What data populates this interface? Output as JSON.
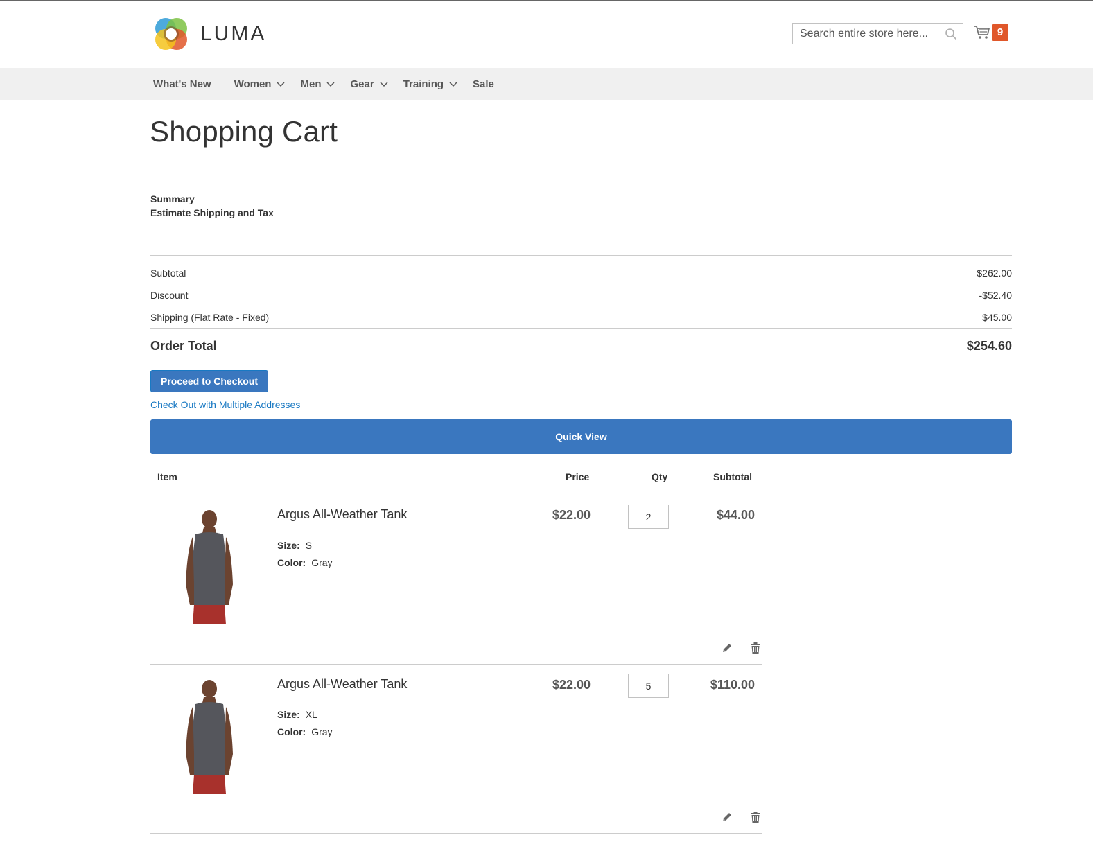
{
  "header": {
    "logo_text": "LUMA",
    "search_placeholder": "Search entire store here...",
    "cart_count": "9",
    "accent_color": "#e0572a"
  },
  "nav": {
    "items": [
      {
        "label": "What's New",
        "has_dropdown": false
      },
      {
        "label": "Women",
        "has_dropdown": true
      },
      {
        "label": "Men",
        "has_dropdown": true
      },
      {
        "label": "Gear",
        "has_dropdown": true
      },
      {
        "label": "Training",
        "has_dropdown": true
      },
      {
        "label": "Sale",
        "has_dropdown": false
      }
    ]
  },
  "page": {
    "title": "Shopping Cart"
  },
  "summary": {
    "title": "Summary",
    "estimate_label": "Estimate Shipping and Tax",
    "rows": [
      {
        "label": "Subtotal",
        "value": "$262.00"
      },
      {
        "label": "Discount",
        "value": "-$52.40"
      },
      {
        "label": "Shipping (Flat Rate - Fixed)",
        "value": "$45.00"
      }
    ],
    "order_total_label": "Order Total",
    "order_total_value": "$254.60",
    "checkout_label": "Proceed to Checkout",
    "multi_address_label": "Check Out with Multiple Addresses",
    "quick_view_label": "Quick View",
    "button_color": "#3a77bf",
    "link_color": "#1979c3"
  },
  "cart_table": {
    "headers": {
      "item": "Item",
      "price": "Price",
      "qty": "Qty",
      "subtotal": "Subtotal"
    },
    "items": [
      {
        "name": "Argus All-Weather Tank",
        "size_label": "Size:",
        "size": "S",
        "color_label": "Color:",
        "color": "Gray",
        "price": "$22.00",
        "qty": "2",
        "subtotal": "$44.00"
      },
      {
        "name": "Argus All-Weather Tank",
        "size_label": "Size:",
        "size": "XL",
        "color_label": "Color:",
        "color": "Gray",
        "price": "$22.00",
        "qty": "5",
        "subtotal": "$110.00"
      }
    ],
    "icons": [
      "pencil-icon",
      "trash-icon"
    ]
  }
}
